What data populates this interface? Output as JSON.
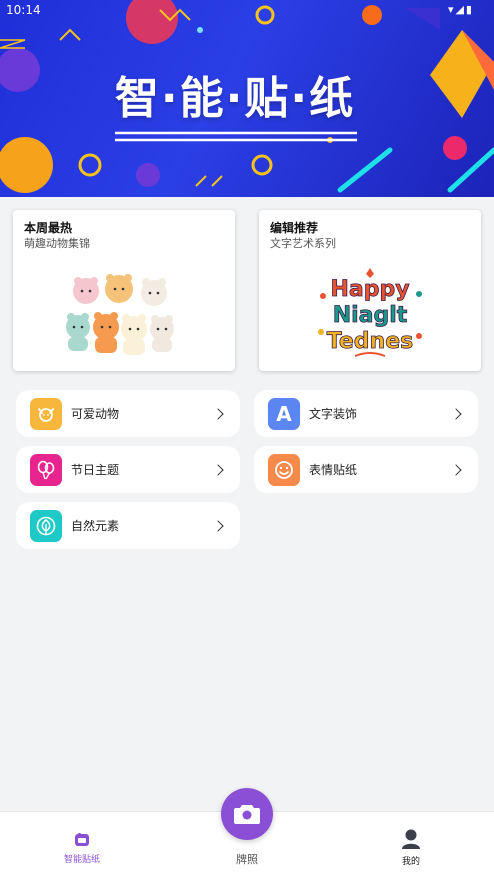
{
  "status_bar": {
    "time": "10:14"
  },
  "banner": {
    "title": "智·能·贴·纸"
  },
  "featured": [
    {
      "title": "本周最热",
      "subtitle": "萌趣动物集锦"
    },
    {
      "title": "编辑推荐",
      "subtitle": "文字艺术系列",
      "art_text": [
        "Happy",
        "Niaglt",
        "Tednes"
      ]
    }
  ],
  "categories": [
    {
      "label": "可爱动物",
      "icon": "dog-face-icon",
      "color": "#f6b73c"
    },
    {
      "label": "文字装饰",
      "icon": "letter-a-icon",
      "color": "#5b86f2",
      "glyph": "A"
    },
    {
      "label": "节日主题",
      "icon": "balloons-icon",
      "color": "#e8248f"
    },
    {
      "label": "表情贴纸",
      "icon": "smiley-icon",
      "color": "#f58a4b"
    },
    {
      "label": "自然元素",
      "icon": "leaf-icon",
      "color": "#1ec9c8"
    }
  ],
  "bottom_nav": {
    "home": {
      "label": "智能贴纸",
      "icon": "sticker-icon",
      "color": "#8b4fd6"
    },
    "camera": {
      "label": "牌照",
      "icon": "camera-icon",
      "color": "#8b4fd6"
    },
    "profile": {
      "label": "我的",
      "icon": "person-icon"
    }
  }
}
